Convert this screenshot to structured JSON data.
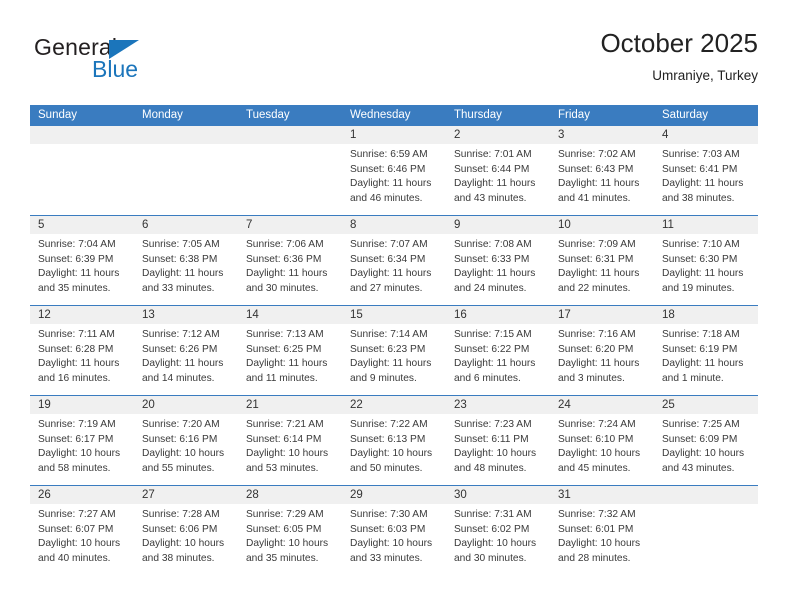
{
  "brand": {
    "name_part1": "General",
    "name_part2": "Blue",
    "triangle_color": "#1b75bb"
  },
  "header": {
    "title": "October 2025",
    "subtitle": "Umraniye, Turkey"
  },
  "theme": {
    "header_blue": "#3a7cc0",
    "daynum_band": "#f0f0f0",
    "text": "#3a3a3a"
  },
  "weekday_headers": [
    "Sunday",
    "Monday",
    "Tuesday",
    "Wednesday",
    "Thursday",
    "Friday",
    "Saturday"
  ],
  "weeks": [
    [
      {
        "day": "",
        "empty": true
      },
      {
        "day": "",
        "empty": true
      },
      {
        "day": "",
        "empty": true
      },
      {
        "day": "1",
        "sunrise": "Sunrise: 6:59 AM",
        "sunset": "Sunset: 6:46 PM",
        "daylight1": "Daylight: 11 hours",
        "daylight2": "and 46 minutes."
      },
      {
        "day": "2",
        "sunrise": "Sunrise: 7:01 AM",
        "sunset": "Sunset: 6:44 PM",
        "daylight1": "Daylight: 11 hours",
        "daylight2": "and 43 minutes."
      },
      {
        "day": "3",
        "sunrise": "Sunrise: 7:02 AM",
        "sunset": "Sunset: 6:43 PM",
        "daylight1": "Daylight: 11 hours",
        "daylight2": "and 41 minutes."
      },
      {
        "day": "4",
        "sunrise": "Sunrise: 7:03 AM",
        "sunset": "Sunset: 6:41 PM",
        "daylight1": "Daylight: 11 hours",
        "daylight2": "and 38 minutes."
      }
    ],
    [
      {
        "day": "5",
        "sunrise": "Sunrise: 7:04 AM",
        "sunset": "Sunset: 6:39 PM",
        "daylight1": "Daylight: 11 hours",
        "daylight2": "and 35 minutes."
      },
      {
        "day": "6",
        "sunrise": "Sunrise: 7:05 AM",
        "sunset": "Sunset: 6:38 PM",
        "daylight1": "Daylight: 11 hours",
        "daylight2": "and 33 minutes."
      },
      {
        "day": "7",
        "sunrise": "Sunrise: 7:06 AM",
        "sunset": "Sunset: 6:36 PM",
        "daylight1": "Daylight: 11 hours",
        "daylight2": "and 30 minutes."
      },
      {
        "day": "8",
        "sunrise": "Sunrise: 7:07 AM",
        "sunset": "Sunset: 6:34 PM",
        "daylight1": "Daylight: 11 hours",
        "daylight2": "and 27 minutes."
      },
      {
        "day": "9",
        "sunrise": "Sunrise: 7:08 AM",
        "sunset": "Sunset: 6:33 PM",
        "daylight1": "Daylight: 11 hours",
        "daylight2": "and 24 minutes."
      },
      {
        "day": "10",
        "sunrise": "Sunrise: 7:09 AM",
        "sunset": "Sunset: 6:31 PM",
        "daylight1": "Daylight: 11 hours",
        "daylight2": "and 22 minutes."
      },
      {
        "day": "11",
        "sunrise": "Sunrise: 7:10 AM",
        "sunset": "Sunset: 6:30 PM",
        "daylight1": "Daylight: 11 hours",
        "daylight2": "and 19 minutes."
      }
    ],
    [
      {
        "day": "12",
        "sunrise": "Sunrise: 7:11 AM",
        "sunset": "Sunset: 6:28 PM",
        "daylight1": "Daylight: 11 hours",
        "daylight2": "and 16 minutes."
      },
      {
        "day": "13",
        "sunrise": "Sunrise: 7:12 AM",
        "sunset": "Sunset: 6:26 PM",
        "daylight1": "Daylight: 11 hours",
        "daylight2": "and 14 minutes."
      },
      {
        "day": "14",
        "sunrise": "Sunrise: 7:13 AM",
        "sunset": "Sunset: 6:25 PM",
        "daylight1": "Daylight: 11 hours",
        "daylight2": "and 11 minutes."
      },
      {
        "day": "15",
        "sunrise": "Sunrise: 7:14 AM",
        "sunset": "Sunset: 6:23 PM",
        "daylight1": "Daylight: 11 hours",
        "daylight2": "and 9 minutes."
      },
      {
        "day": "16",
        "sunrise": "Sunrise: 7:15 AM",
        "sunset": "Sunset: 6:22 PM",
        "daylight1": "Daylight: 11 hours",
        "daylight2": "and 6 minutes."
      },
      {
        "day": "17",
        "sunrise": "Sunrise: 7:16 AM",
        "sunset": "Sunset: 6:20 PM",
        "daylight1": "Daylight: 11 hours",
        "daylight2": "and 3 minutes."
      },
      {
        "day": "18",
        "sunrise": "Sunrise: 7:18 AM",
        "sunset": "Sunset: 6:19 PM",
        "daylight1": "Daylight: 11 hours",
        "daylight2": "and 1 minute."
      }
    ],
    [
      {
        "day": "19",
        "sunrise": "Sunrise: 7:19 AM",
        "sunset": "Sunset: 6:17 PM",
        "daylight1": "Daylight: 10 hours",
        "daylight2": "and 58 minutes."
      },
      {
        "day": "20",
        "sunrise": "Sunrise: 7:20 AM",
        "sunset": "Sunset: 6:16 PM",
        "daylight1": "Daylight: 10 hours",
        "daylight2": "and 55 minutes."
      },
      {
        "day": "21",
        "sunrise": "Sunrise: 7:21 AM",
        "sunset": "Sunset: 6:14 PM",
        "daylight1": "Daylight: 10 hours",
        "daylight2": "and 53 minutes."
      },
      {
        "day": "22",
        "sunrise": "Sunrise: 7:22 AM",
        "sunset": "Sunset: 6:13 PM",
        "daylight1": "Daylight: 10 hours",
        "daylight2": "and 50 minutes."
      },
      {
        "day": "23",
        "sunrise": "Sunrise: 7:23 AM",
        "sunset": "Sunset: 6:11 PM",
        "daylight1": "Daylight: 10 hours",
        "daylight2": "and 48 minutes."
      },
      {
        "day": "24",
        "sunrise": "Sunrise: 7:24 AM",
        "sunset": "Sunset: 6:10 PM",
        "daylight1": "Daylight: 10 hours",
        "daylight2": "and 45 minutes."
      },
      {
        "day": "25",
        "sunrise": "Sunrise: 7:25 AM",
        "sunset": "Sunset: 6:09 PM",
        "daylight1": "Daylight: 10 hours",
        "daylight2": "and 43 minutes."
      }
    ],
    [
      {
        "day": "26",
        "sunrise": "Sunrise: 7:27 AM",
        "sunset": "Sunset: 6:07 PM",
        "daylight1": "Daylight: 10 hours",
        "daylight2": "and 40 minutes."
      },
      {
        "day": "27",
        "sunrise": "Sunrise: 7:28 AM",
        "sunset": "Sunset: 6:06 PM",
        "daylight1": "Daylight: 10 hours",
        "daylight2": "and 38 minutes."
      },
      {
        "day": "28",
        "sunrise": "Sunrise: 7:29 AM",
        "sunset": "Sunset: 6:05 PM",
        "daylight1": "Daylight: 10 hours",
        "daylight2": "and 35 minutes."
      },
      {
        "day": "29",
        "sunrise": "Sunrise: 7:30 AM",
        "sunset": "Sunset: 6:03 PM",
        "daylight1": "Daylight: 10 hours",
        "daylight2": "and 33 minutes."
      },
      {
        "day": "30",
        "sunrise": "Sunrise: 7:31 AM",
        "sunset": "Sunset: 6:02 PM",
        "daylight1": "Daylight: 10 hours",
        "daylight2": "and 30 minutes."
      },
      {
        "day": "31",
        "sunrise": "Sunrise: 7:32 AM",
        "sunset": "Sunset: 6:01 PM",
        "daylight1": "Daylight: 10 hours",
        "daylight2": "and 28 minutes."
      },
      {
        "day": "",
        "empty": true
      }
    ]
  ]
}
